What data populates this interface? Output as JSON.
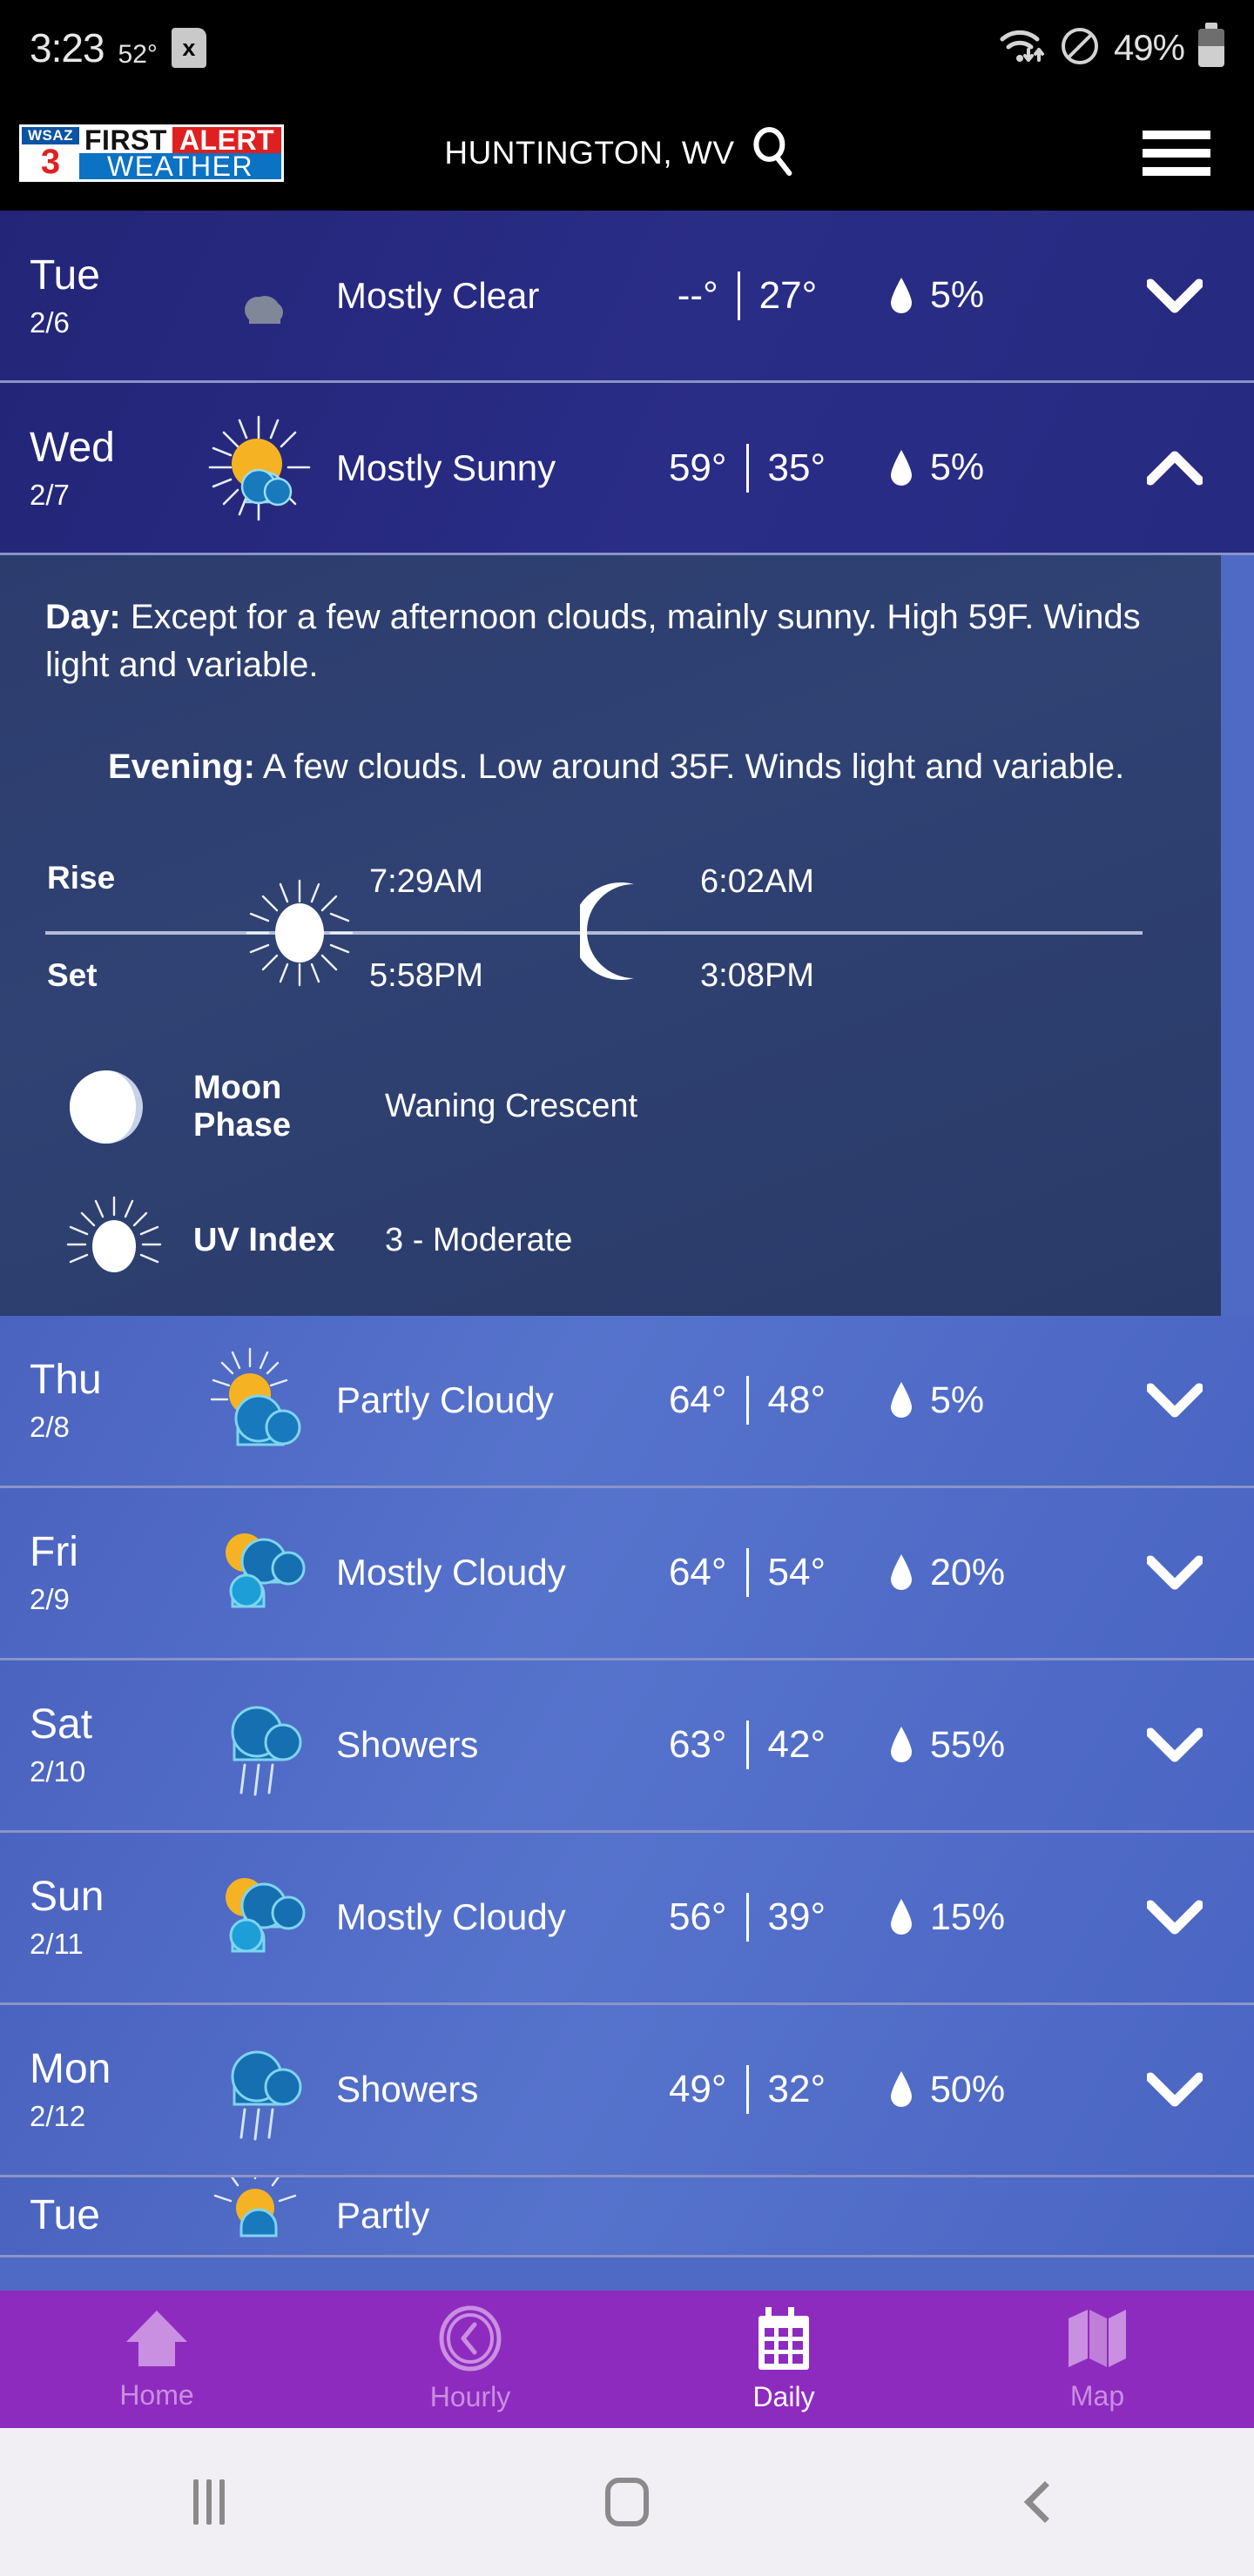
{
  "status_bar": {
    "time": "3:23",
    "temperature": "52°",
    "x_chip": "x",
    "wifi_icon": "wifi-icon",
    "dnd_icon": "do-not-disturb-icon",
    "battery_percent": "49%",
    "battery_icon": "battery-icon"
  },
  "app_bar": {
    "logo": {
      "station": "WSAZ",
      "channel": "3",
      "first": "FIRST",
      "alert": "ALERT",
      "weather": "WEATHER"
    },
    "location": "HUNTINGTON, WV",
    "search_icon": "search-icon",
    "menu_icon": "hamburger-menu-icon"
  },
  "colors": {
    "row_dark": "#232578",
    "row_light": "#4e6ac4",
    "detail_panel": "#2c3c6d",
    "nav_bar": "#8e2bbf",
    "nav_active": "#ffffff",
    "nav_inactive": "#c98fe0",
    "accent_red": "#e02020",
    "accent_blue": "#0b72c4",
    "sun_yellow": "#f5b324",
    "cloud_blue": "#1879bd"
  },
  "forecast": [
    {
      "day": "Tue",
      "date": "2/6",
      "icon": "moon-cloud-icon",
      "condition": "Mostly Clear",
      "high": "--°",
      "low": "27°",
      "precip": "5%",
      "chevron": "chevron-down-icon",
      "expanded": false,
      "theme": "dark"
    },
    {
      "day": "Wed",
      "date": "2/7",
      "icon": "sun-cloud-icon",
      "condition": "Mostly Sunny",
      "high": "59°",
      "low": "35°",
      "precip": "5%",
      "chevron": "chevron-up-icon",
      "expanded": true,
      "theme": "dark"
    },
    {
      "day": "Thu",
      "date": "2/8",
      "icon": "sun-behind-cloud-icon",
      "condition": "Partly Cloudy",
      "high": "64°",
      "low": "48°",
      "precip": "5%",
      "chevron": "chevron-down-icon",
      "expanded": false,
      "theme": "light"
    },
    {
      "day": "Fri",
      "date": "2/9",
      "icon": "sun-two-clouds-icon",
      "condition": "Mostly Cloudy",
      "high": "64°",
      "low": "54°",
      "precip": "20%",
      "chevron": "chevron-down-icon",
      "expanded": false,
      "theme": "light"
    },
    {
      "day": "Sat",
      "date": "2/10",
      "icon": "rain-cloud-icon",
      "condition": "Showers",
      "high": "63°",
      "low": "42°",
      "precip": "55%",
      "chevron": "chevron-down-icon",
      "expanded": false,
      "theme": "light"
    },
    {
      "day": "Sun",
      "date": "2/11",
      "icon": "sun-two-clouds-icon",
      "condition": "Mostly Cloudy",
      "high": "56°",
      "low": "39°",
      "precip": "15%",
      "chevron": "chevron-down-icon",
      "expanded": false,
      "theme": "light"
    },
    {
      "day": "Mon",
      "date": "2/12",
      "icon": "rain-cloud-icon",
      "condition": "Showers",
      "high": "49°",
      "low": "32°",
      "precip": "50%",
      "chevron": "chevron-down-icon",
      "expanded": false,
      "theme": "light"
    },
    {
      "day": "Tue",
      "date": "",
      "icon": "sunrise-cloud-icon",
      "condition": "Partly",
      "high": "",
      "low": "",
      "precip": "",
      "chevron": "chevron-down-icon",
      "expanded": false,
      "theme": "light"
    }
  ],
  "detail": {
    "day_label": "Day:",
    "day_text": "Except for a few afternoon clouds, mainly sunny. High 59F. Winds light and variable.",
    "evening_label": "Evening:",
    "evening_text": "A few clouds. Low around 35F. Winds light and variable.",
    "rise_label": "Rise",
    "set_label": "Set",
    "sun_icon": "sun-icon",
    "moon_icon": "crescent-moon-icon",
    "sun_rise": "7:29AM",
    "sun_set": "5:58PM",
    "moon_rise": "6:02AM",
    "moon_set": "3:08PM",
    "moon_phase_icon": "moon-phase-icon",
    "moon_phase_label": "Moon Phase",
    "moon_phase_value": "Waning Crescent",
    "uv_icon": "uv-sun-icon",
    "uv_label": "UV Index",
    "uv_value": "3 - Moderate"
  },
  "bottom_nav": [
    {
      "label": "Home",
      "icon": "home-icon",
      "active": false
    },
    {
      "label": "Hourly",
      "icon": "clock-icon",
      "active": false
    },
    {
      "label": "Daily",
      "icon": "calendar-icon",
      "active": true
    },
    {
      "label": "Map",
      "icon": "map-icon",
      "active": false
    }
  ],
  "system_nav": {
    "recent_icon": "recent-apps-icon",
    "home_icon": "system-home-icon",
    "back_icon": "system-back-icon"
  }
}
